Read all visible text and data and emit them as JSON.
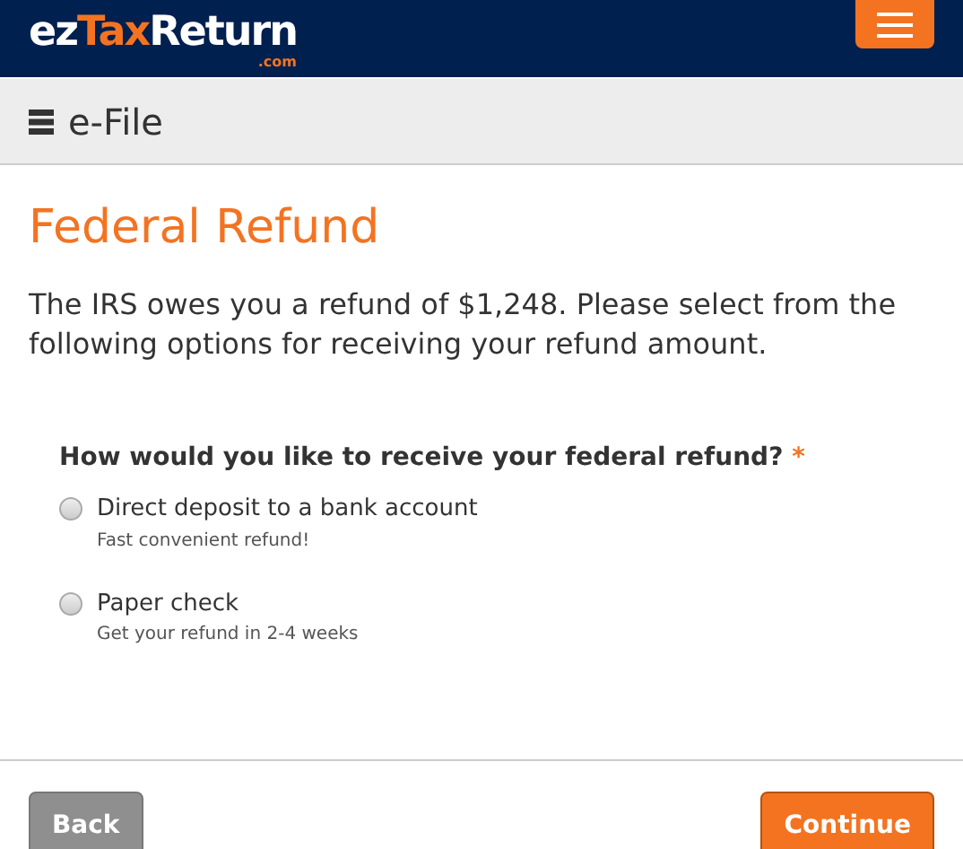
{
  "logo": {
    "prefix": "ez",
    "highlight": "Tax",
    "suffix": "Return",
    "domain": ".com"
  },
  "section": {
    "title": "e-File"
  },
  "page": {
    "title": "Federal Refund",
    "intro": "The IRS owes you a refund of $1,248. Please select from the following options for receiving your refund amount."
  },
  "question": {
    "label": "How would you like to receive your federal refund?",
    "required_mark": "*",
    "options": [
      {
        "label": "Direct deposit to a bank account",
        "hint": "Fast convenient refund!",
        "selected": false
      },
      {
        "label": "Paper check",
        "hint": "Get your refund in 2-4 weeks",
        "selected": false
      }
    ]
  },
  "buttons": {
    "back": "Back",
    "continue": "Continue"
  }
}
